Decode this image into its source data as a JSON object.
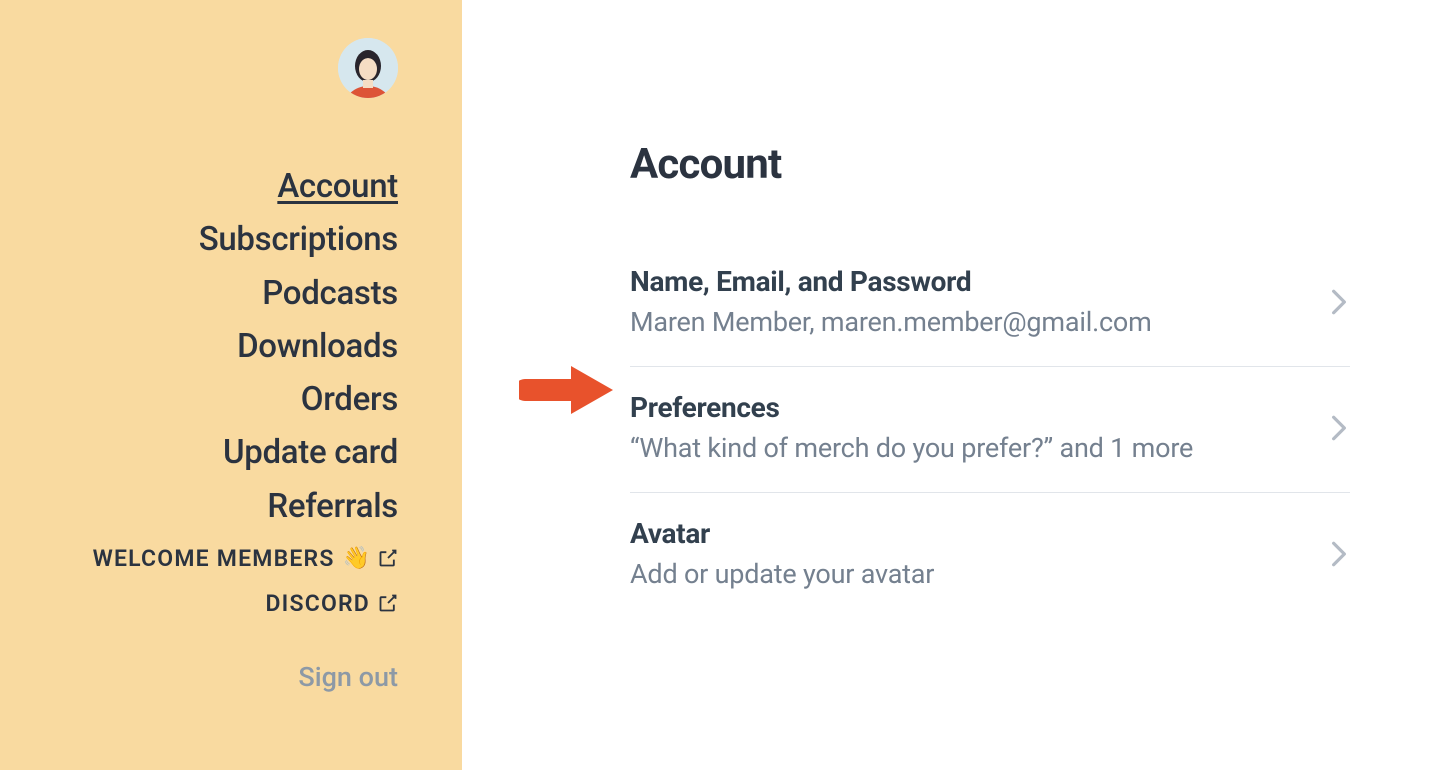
{
  "sidebar": {
    "items": [
      {
        "label": "Account",
        "active": true
      },
      {
        "label": "Subscriptions",
        "active": false
      },
      {
        "label": "Podcasts",
        "active": false
      },
      {
        "label": "Downloads",
        "active": false
      },
      {
        "label": "Orders",
        "active": false
      },
      {
        "label": "Update card",
        "active": false
      },
      {
        "label": "Referrals",
        "active": false
      }
    ],
    "external": [
      {
        "label": "WELCOME MEMBERS",
        "emoji": "👋"
      },
      {
        "label": "DISCORD",
        "emoji": ""
      }
    ],
    "signout_label": "Sign out"
  },
  "main": {
    "title": "Account",
    "rows": [
      {
        "title": "Name, Email, and Password",
        "sub": "Maren Member, maren.member@gmail.com"
      },
      {
        "title": "Preferences",
        "sub": "“What kind of merch do you prefer?” and 1 more"
      },
      {
        "title": "Avatar",
        "sub": "Add or update your avatar"
      }
    ]
  },
  "colors": {
    "sidebar_bg": "#f9daa0",
    "text_dark": "#2b3340",
    "text_muted": "#74808f",
    "text_light": "#8d99a6",
    "accent_arrow": "#e8522c",
    "avatar_shirt": "#dd5437",
    "avatar_skin": "#f5ddc4",
    "avatar_hair": "#29252c"
  }
}
